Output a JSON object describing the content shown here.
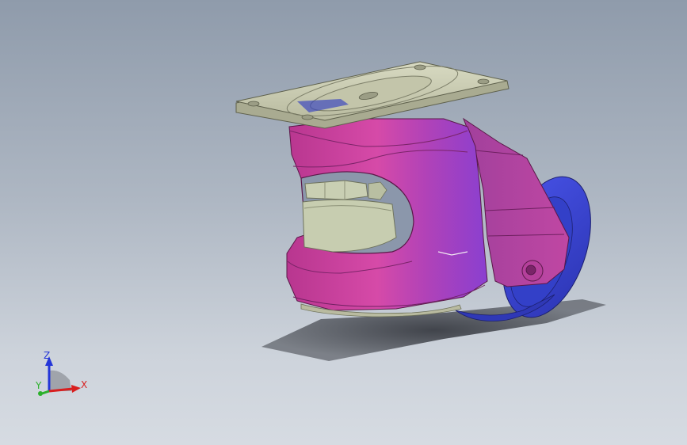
{
  "viewport": {
    "background_top": "#8f9bab",
    "background_bottom": "#d6dbe2"
  },
  "model": {
    "description_icon": "leveling-caster-3d-model",
    "colors": {
      "housing": "#c23f9b",
      "housing_highlight": "#e46fc4",
      "housing_shadow": "#8a2a6e",
      "housing_violet": "#8a3fd0",
      "mount_plate": "#c9cbb0",
      "mount_plate_edge": "#9c9e84",
      "leveling_pad": "#c8ceb0",
      "wheel": "#3a45d8",
      "wheel_dark": "#2a2f9a",
      "shadow": "#3f4248"
    }
  },
  "triad": {
    "x_label": "X",
    "y_label": "Y",
    "z_label": "Z",
    "x_color": "#d81f1f",
    "y_color": "#2bb02b",
    "z_color": "#2436d8"
  }
}
